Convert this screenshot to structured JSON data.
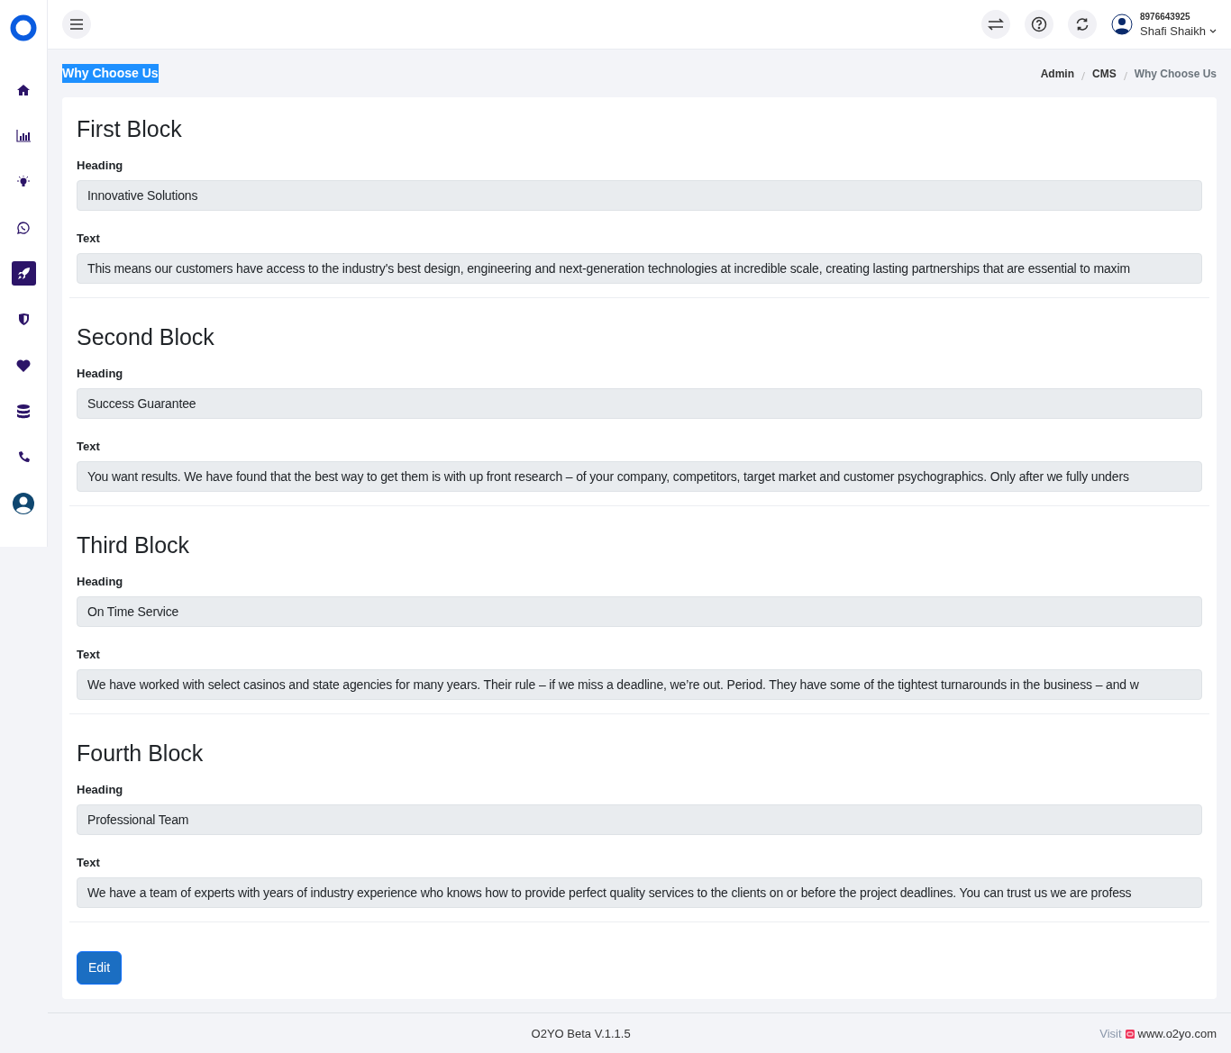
{
  "sidebar": {
    "items": [
      {
        "selected": false
      },
      {
        "selected": false
      },
      {
        "selected": false
      },
      {
        "selected": false
      },
      {
        "selected": true
      },
      {
        "selected": false
      },
      {
        "selected": false
      },
      {
        "selected": false
      },
      {
        "selected": false
      },
      {
        "selected": false
      }
    ]
  },
  "header": {
    "phone": "8976643925",
    "user": "Shafi Shaikh"
  },
  "page_title": "Why Choose Us",
  "breadcrumb": [
    {
      "label": "Admin",
      "selected": false
    },
    {
      "label": "CMS",
      "selected": false
    },
    {
      "label": "Why Choose Us",
      "selected": true
    }
  ],
  "blocks": [
    {
      "title": "First Block",
      "heading_label": "Heading",
      "heading": "Innovative Solutions",
      "text_label": "Text",
      "text": "This means our customers have access to the industry's best design, engineering and next-generation technologies at incredible scale, creating lasting partnerships that are essential to maxim"
    },
    {
      "title": "Second Block",
      "heading_label": "Heading",
      "heading": "Success Guarantee",
      "text_label": "Text",
      "text": "You want results. We have found that the best way to get them is with up front research – of your company, competitors, target market and customer psychographics. Only after we fully unders"
    },
    {
      "title": "Third Block",
      "heading_label": "Heading",
      "heading": "On Time Service",
      "text_label": "Text",
      "text": "We have worked with select casinos and state agencies for many years. Their rule – if we miss a deadline, we’re out. Period. They have some of the tightest turnarounds in the business – and w"
    },
    {
      "title": "Fourth Block",
      "heading_label": "Heading",
      "heading": "Professional Team",
      "text_label": "Text",
      "text": "We have a team of experts with years of industry experience who knows how to provide perfect quality services to the clients on or before the project deadlines. You can trust us we are profess"
    }
  ],
  "edit_button": "Edit",
  "footer": {
    "version": "O2YO Beta V.1.1.5",
    "visit": "Visit",
    "site": "www.o2yo.com"
  }
}
